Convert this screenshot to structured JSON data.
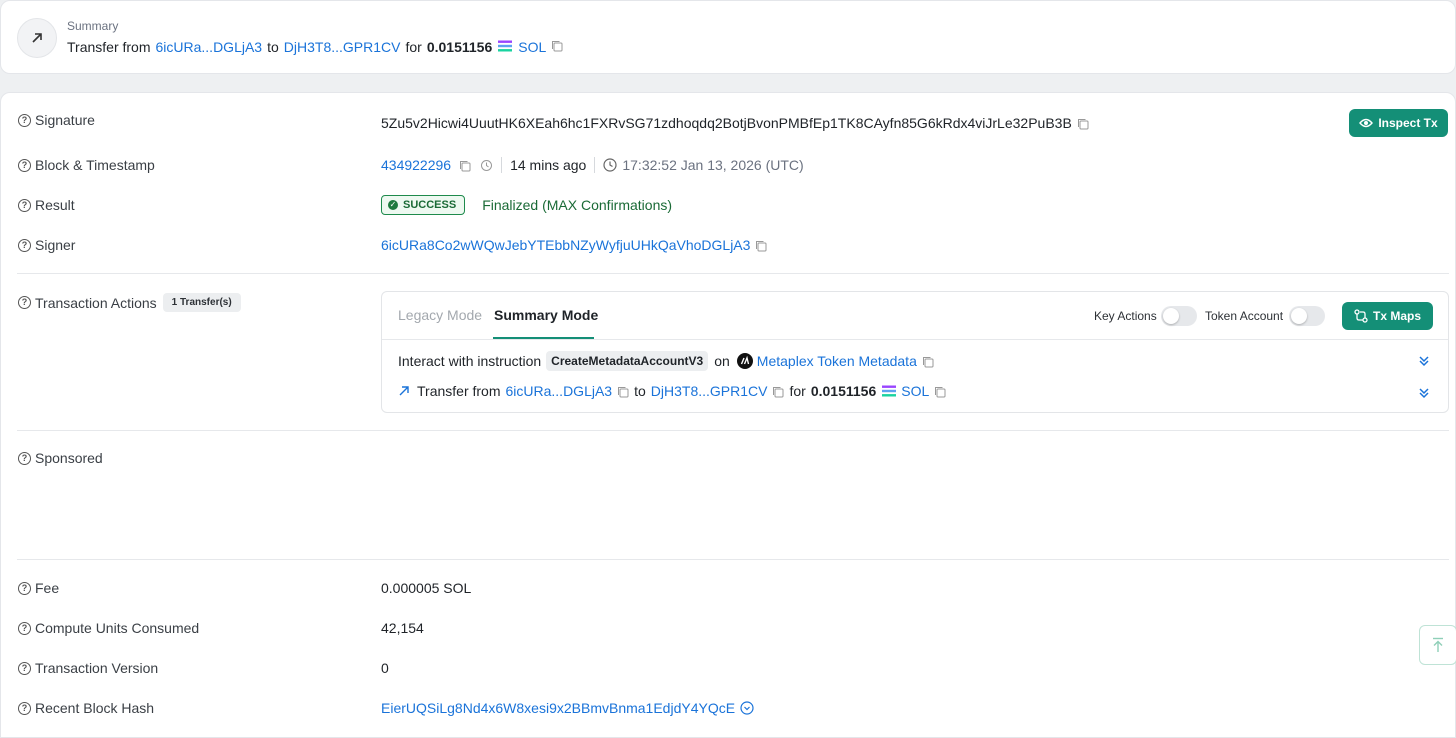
{
  "summary": {
    "label": "Summary",
    "prefix": "Transfer from",
    "from": "6icURa...DGLjA3",
    "to_word": "to",
    "to": "DjH3T8...GPR1CV",
    "for_word": "for",
    "amount": "0.0151156",
    "token": "SOL"
  },
  "signature": {
    "label": "Signature",
    "value": "5Zu5v2Hicwi4UuutHK6XEah6hc1FXRvSG71zdhoqdq2BotjBvonPMBfEp1TK8CAyfn85G6kRdx4viJrLe32PuB3B",
    "inspect_label": "Inspect Tx"
  },
  "block": {
    "label": "Block & Timestamp",
    "slot": "434922296",
    "ago": "14 mins ago",
    "timestamp": "17:32:52 Jan 13, 2026 (UTC)"
  },
  "result": {
    "label": "Result",
    "badge": "SUCCESS",
    "status": "Finalized (MAX Confirmations)"
  },
  "signer": {
    "label": "Signer",
    "value": "6icURa8Co2wWQwJebYTEbbNZyWyfjuUHkQaVhoDGLjA3"
  },
  "actions": {
    "label": "Transaction Actions",
    "count_badge": "1 Transfer(s)",
    "tabs": [
      "Legacy Mode",
      "Summary Mode"
    ],
    "toggles": [
      "Key Actions",
      "Token Account"
    ],
    "txmaps_label": "Tx Maps",
    "instruction": {
      "prefix": "Interact with instruction",
      "name": "CreateMetadataAccountV3",
      "on_word": "on",
      "program": "Metaplex Token Metadata"
    },
    "transfer": {
      "prefix": "Transfer from",
      "from": "6icURa...DGLjA3",
      "to_word": "to",
      "to": "DjH3T8...GPR1CV",
      "for_word": "for",
      "amount": "0.0151156",
      "token": "SOL"
    }
  },
  "sponsored": {
    "label": "Sponsored"
  },
  "fee": {
    "label": "Fee",
    "value": "0.000005 SOL"
  },
  "compute": {
    "label": "Compute Units Consumed",
    "value": "42,154"
  },
  "version": {
    "label": "Transaction Version",
    "value": "0"
  },
  "blockhash": {
    "label": "Recent Block Hash",
    "value": "EierUQSiLg8Nd4x6W8xesi9x2BBmvBnma1EdjdY4YQcE"
  },
  "colors": {
    "accent": "#148f77",
    "link": "#1a73d9",
    "success": "#1a6a36"
  }
}
